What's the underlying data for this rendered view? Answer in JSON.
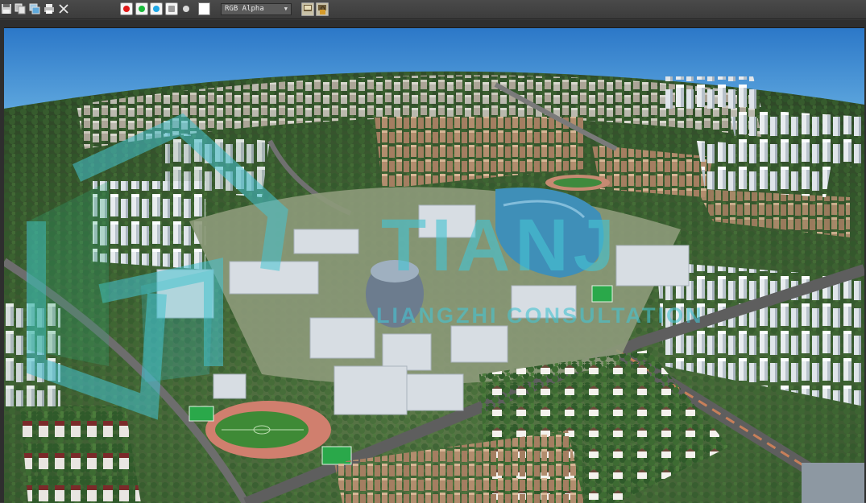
{
  "toolbar": {
    "icons": [
      "save-icon",
      "copy-icon",
      "clone-icon",
      "print-icon",
      "close-icon"
    ],
    "channels": [
      {
        "name": "red-channel",
        "color": "#e01818"
      },
      {
        "name": "green-channel",
        "color": "#19b93a"
      },
      {
        "name": "blue-channel",
        "color": "#1ea7e6"
      },
      {
        "name": "mono-channel",
        "color": "#9a9a9a"
      }
    ],
    "alpha_dot_color": "#d8d8d8",
    "swatch_color": "#ffffff",
    "channel_display": {
      "selected": "RGB Alpha"
    },
    "right_icons": [
      "display-image-icon",
      "lock-image-icon"
    ]
  },
  "viewport": {
    "content": "aerial-city-rendering",
    "watermark": {
      "brand": "TIANJ",
      "subtitle": "LIANGZHI CONSULTATION",
      "color": "#46c3d2"
    }
  }
}
